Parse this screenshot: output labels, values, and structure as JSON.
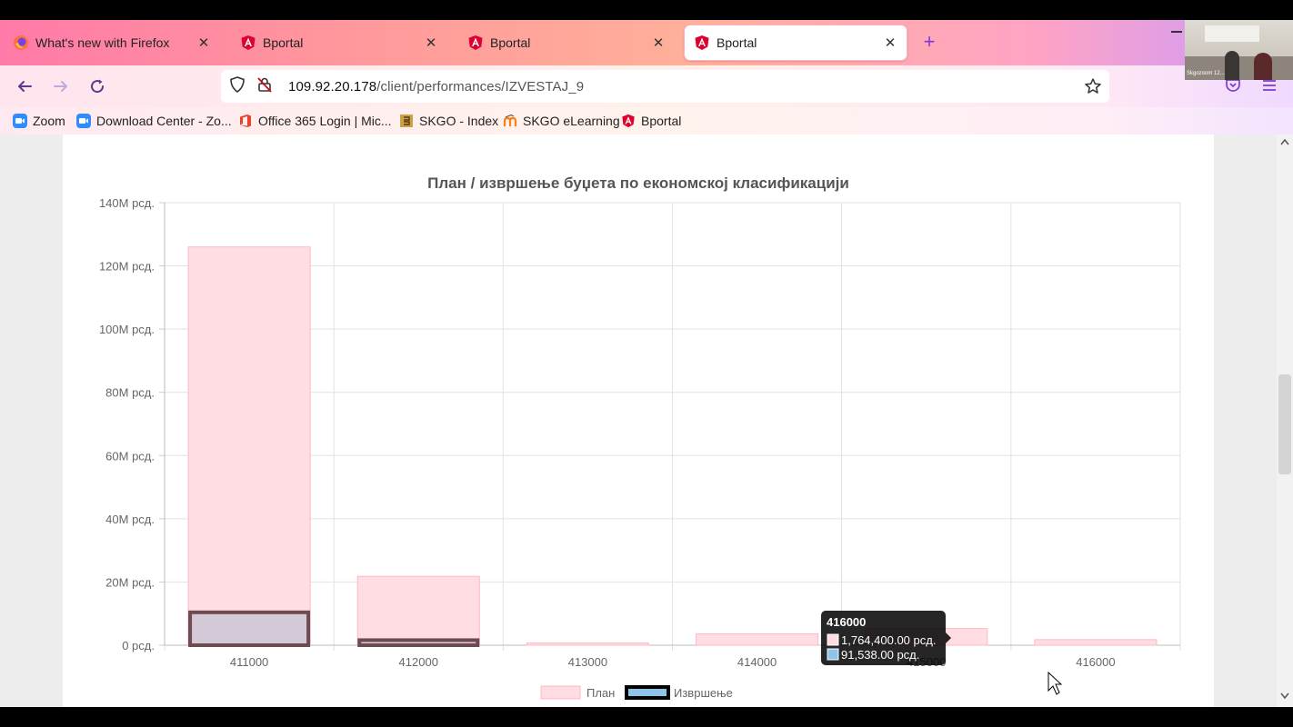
{
  "tabs": [
    {
      "label": "What's new with Firefox",
      "icon": "firefox-icon",
      "active": false
    },
    {
      "label": "Bportal",
      "icon": "angular-icon",
      "active": false
    },
    {
      "label": "Bportal",
      "icon": "angular-icon",
      "active": false
    },
    {
      "label": "Bportal",
      "icon": "angular-icon",
      "active": true
    }
  ],
  "address": {
    "host": "109.92.20.178",
    "path": "/client/performances/IZVESTAJ_9"
  },
  "bookmarks": [
    {
      "label": "Zoom",
      "icon": "zoom-icon"
    },
    {
      "label": "Download Center - Zo...",
      "icon": "zoom-icon"
    },
    {
      "label": "Office 365 Login | Mic...",
      "icon": "office-icon"
    },
    {
      "label": "SKGO - Index",
      "icon": "skgo-icon"
    },
    {
      "label": "SKGO eLearning",
      "icon": "moodle-icon"
    },
    {
      "label": "Bportal",
      "icon": "angular-icon"
    }
  ],
  "webcam": {
    "caption": "Skgozoom 12..."
  },
  "colors": {
    "plan_fill": "#ffdde2",
    "plan_border": "#ffb9c4",
    "exec_fill": "#d4c9d6",
    "exec_border": "#6e4b50",
    "legend_exec_fill": "#8ec3ea",
    "tooltip_bg": "#000000"
  },
  "chart_data": {
    "type": "bar",
    "title": "План / извршење буџета по економској класификацији",
    "categories": [
      "411000",
      "412000",
      "413000",
      "414000",
      "415000",
      "416000"
    ],
    "series": [
      {
        "name": "План",
        "values": [
          126000000,
          21800000,
          700000,
          3600000,
          5300000,
          1764400
        ]
      },
      {
        "name": "Извршење",
        "values": [
          10400000,
          1600000,
          0,
          0,
          0,
          91538
        ]
      }
    ],
    "ylim": [
      0,
      140000000
    ],
    "yticks": [
      "140M рсд.",
      "120M рсд.",
      "100M рсд.",
      "80M рсд.",
      "60M рсд.",
      "40M рсд.",
      "20M рсд.",
      "0 рсд."
    ],
    "ytick_values": [
      140000000,
      120000000,
      100000000,
      80000000,
      60000000,
      40000000,
      20000000,
      0
    ],
    "grid": true,
    "legend_position": "bottom",
    "tooltip": {
      "category": "416000",
      "lines": [
        "1,764,400.00 рсд.",
        "91,538.00 рсд."
      ]
    }
  }
}
